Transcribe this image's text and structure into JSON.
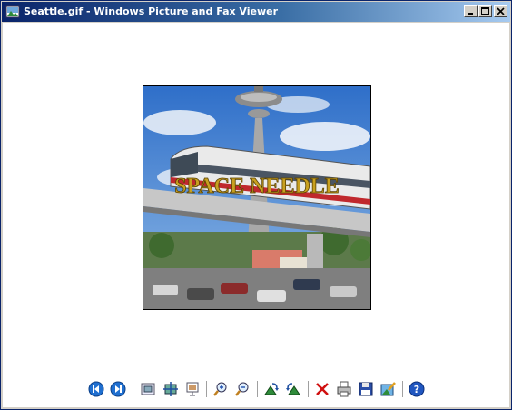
{
  "window": {
    "title": "Seattle.gif - Windows Picture and Fax Viewer",
    "controls": [
      "minimize",
      "maximize",
      "close"
    ]
  },
  "image": {
    "overlay_text": "SPACE NEEDLE"
  },
  "toolbar": {
    "buttons": [
      {
        "name": "previous-image",
        "icon": "previous-icon"
      },
      {
        "name": "next-image",
        "icon": "next-icon"
      },
      {
        "name": "best-fit",
        "icon": "best-fit-icon"
      },
      {
        "name": "actual-size",
        "icon": "actual-size-icon"
      },
      {
        "name": "slide-show",
        "icon": "slideshow-icon"
      },
      {
        "name": "zoom-in",
        "icon": "zoom-in-icon"
      },
      {
        "name": "zoom-out",
        "icon": "zoom-out-icon"
      },
      {
        "name": "rotate-clockwise",
        "icon": "rotate-clockwise-icon"
      },
      {
        "name": "rotate-counterclockwise",
        "icon": "rotate-counterclockwise-icon"
      },
      {
        "name": "delete",
        "icon": "delete-icon"
      },
      {
        "name": "print",
        "icon": "print-icon"
      },
      {
        "name": "copy-to",
        "icon": "save-icon"
      },
      {
        "name": "edit",
        "icon": "edit-icon"
      },
      {
        "name": "help",
        "icon": "help-icon"
      }
    ]
  },
  "colors": {
    "titlebar_start": "#0a246a",
    "titlebar_end": "#a6caf0",
    "overlay_text": "#c8a020"
  }
}
